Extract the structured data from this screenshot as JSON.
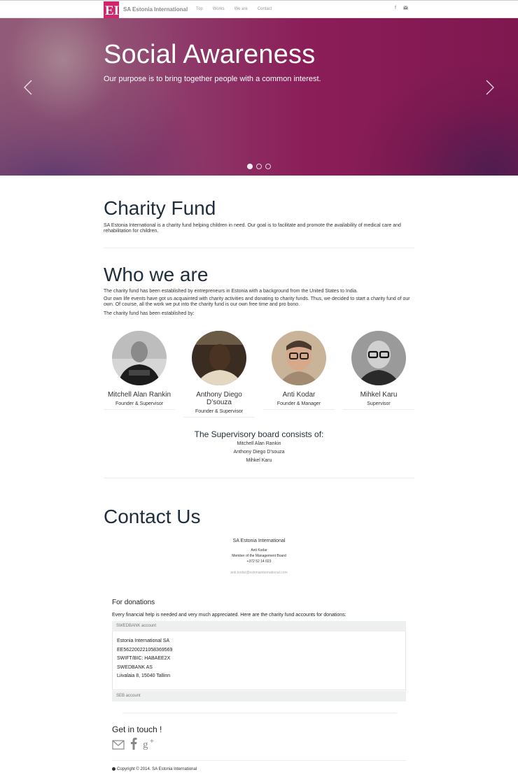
{
  "nav": {
    "logo": "EI",
    "brand": "SA Estonia International",
    "links": [
      "Top",
      "Works",
      "We are",
      "Contact"
    ],
    "icons": [
      "facebook-icon",
      "email-icon"
    ]
  },
  "hero": {
    "title": "Social Awareness",
    "subtitle": "Our purpose is to bring together people with a common interest.",
    "slide_count": 3,
    "active_slide": 1
  },
  "charity": {
    "title": "Charity Fund",
    "text": "SA Estonia International is a charity fund helping children in need. Our goal is to facilitate and promote the availability of medical care and rehabilitation for children."
  },
  "who": {
    "title": "Who we are",
    "para1": "The charity fund has been established by entrepreneurs in Estonia with a background from the United States to India.",
    "para2": "Our own life events have got us acquainted with charity activities and donating to charity funds. Thus, we decided to start a charity fund of our own. Of course, all the work we put into the charity fund is our own free time and pro bono.",
    "para3": "The charity fund has been established by:",
    "people": [
      {
        "name": "Mitchell Alan Rankin",
        "role": "Founder & Supervisor"
      },
      {
        "name": "Anthony Diego D’souza",
        "role": "Founder & Supervisor"
      },
      {
        "name": "Anti Kodar",
        "role": "Founder & Manager"
      },
      {
        "name": "Mihkel Karu",
        "role": "Supervisor"
      }
    ],
    "board_title": "The Supervisory board consists of:",
    "board": [
      "Mitchell Alan Rankin",
      "Anthony Diego D’souza",
      "Mihkel Karu"
    ]
  },
  "contact": {
    "title": "Contact Us",
    "org": "SA Estonia International",
    "person": "Anti Kodar",
    "position": "Member of the Management Board",
    "phone": "+372 52 14 023",
    "email": "anti.kodar@estoniainternational.com"
  },
  "donations": {
    "title": "For donations",
    "text": "Every financial help is needed and very much appreciated. Here are the charity fund accounts for donations:",
    "swedbank_label": "SWEDBANK account",
    "swedbank_lines": [
      "Estonia International SA",
      "EE562200221058369569",
      "SWIFT/BIC: HABAEE2X",
      "SWEDBANK AS",
      "Liivalaia 8, 15040 Tallinn"
    ],
    "seb_label": "SEB account"
  },
  "touch": {
    "title": "Get in touch !",
    "icons": [
      "email-icon",
      "facebook-icon",
      "google-plus-icon"
    ]
  },
  "footer": {
    "copyright": "Copyright © 2014. SA Estonia International"
  },
  "colors": {
    "brand": "#d0266e",
    "hero": "#8b1d58",
    "heading": "#1f2d3d"
  }
}
